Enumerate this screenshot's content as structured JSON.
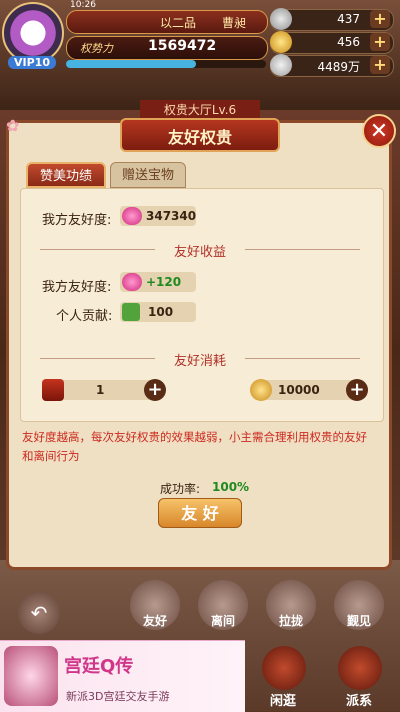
{
  "status_bar": {
    "time": "10:26"
  },
  "player": {
    "vip": "VIP10",
    "name": "以二品",
    "title": "曹昶",
    "power_label": "权势力",
    "power_value": "1569472"
  },
  "resources": [
    {
      "icon": "ingot-icon",
      "value": "437"
    },
    {
      "icon": "gold-ingot-icon",
      "value": "456"
    },
    {
      "icon": "coin-icon",
      "value": "4489万"
    }
  ],
  "background": {
    "banner": "权贵大厅Lv.6"
  },
  "dialog": {
    "title": "友好权贵",
    "close": "✕",
    "tabs": [
      {
        "label": "赞美功绩",
        "active": true
      },
      {
        "label": "赠送宝物",
        "active": false
      }
    ],
    "my_friendship_label": "我方友好度:",
    "my_friendship_value": "347340",
    "section_gain": "友好收益",
    "gain_friendship_label": "我方友好度:",
    "gain_friendship_value": "+120",
    "gain_contribution_label": "个人贡献:",
    "gain_contribution_value": "100",
    "section_cost": "友好消耗",
    "cost_item_value": "1",
    "cost_coin_value": "10000",
    "note": "友好度越高，每次友好权贵的效果越弱，小主需合理利用权贵的友好和离间行为",
    "rate_label": "成功率:",
    "rate_value": "100%",
    "action_button": "友 好"
  },
  "actions": [
    {
      "label": "友好"
    },
    {
      "label": "离间"
    },
    {
      "label": "拉拢"
    },
    {
      "label": "觐见"
    }
  ],
  "bottom_nav": [
    {
      "label": "闲逛"
    },
    {
      "label": "派系"
    }
  ],
  "ad": {
    "title": "宫廷Q传",
    "subtitle": "新派3D宫廷交友手游"
  },
  "colors": {
    "accent_red": "#b1322a",
    "green": "#1f8a1f",
    "panel": "#f7ecd6"
  }
}
